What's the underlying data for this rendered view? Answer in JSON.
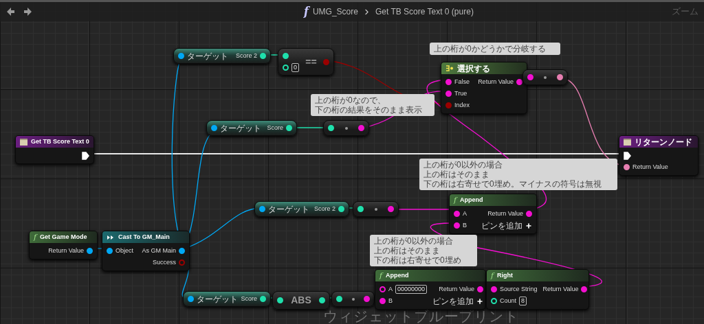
{
  "toolbar": {
    "glyph": "f",
    "breadcrumb": [
      "UMG_Score",
      "Get TB Score Text 0 (pure)"
    ],
    "zoom_label": "ズーム"
  },
  "nodes": [
    {
      "kind": "getter",
      "inputs": [
        {
          "label": "ターゲット",
          "kind": "object",
          "connected": true
        }
      ],
      "outputs": [
        {
          "label": "Score 2",
          "kind": "int",
          "connected": true
        }
      ]
    },
    {
      "kind": "compare",
      "title": "==",
      "inputs": [
        {
          "kind": "int",
          "connected": true
        },
        {
          "kind": "int",
          "connected": false,
          "value": "0"
        }
      ],
      "outputs": [
        {
          "kind": "bool",
          "connected": true
        }
      ]
    },
    {
      "kind": "getter",
      "inputs": [
        {
          "label": "ターゲット",
          "kind": "object",
          "connected": true
        }
      ],
      "outputs": [
        {
          "label": "Score",
          "kind": "int",
          "connected": true
        }
      ]
    },
    {
      "kind": "conversion",
      "inputs": [
        {
          "kind": "int",
          "connected": true
        }
      ],
      "outputs": [
        {
          "kind": "string",
          "connected": true
        }
      ]
    },
    {
      "kind": "select",
      "title": "選択する",
      "inputs": [
        {
          "label": "False",
          "kind": "string",
          "connected": true
        },
        {
          "label": "True",
          "kind": "string",
          "connected": true
        },
        {
          "label": "Index",
          "kind": "bool",
          "connected": true
        }
      ],
      "outputs": [
        {
          "label": "Return Value",
          "kind": "string",
          "connected": true
        }
      ]
    },
    {
      "kind": "conversion",
      "inputs": [
        {
          "kind": "string",
          "connected": true
        }
      ],
      "outputs": [
        {
          "kind": "text",
          "connected": true
        }
      ]
    },
    {
      "kind": "entry",
      "title": "Get TB Score Text 0",
      "outputs": [
        {
          "kind": "exec",
          "connected": true
        }
      ]
    },
    {
      "kind": "result",
      "title": "リターンノード",
      "inputs": [
        {
          "kind": "exec",
          "connected": true
        },
        {
          "label": "Return Value",
          "kind": "text",
          "connected": true
        }
      ]
    },
    {
      "kind": "getter",
      "inputs": [
        {
          "label": "ターゲット",
          "kind": "object",
          "connected": true
        }
      ],
      "outputs": [
        {
          "label": "Score 2",
          "kind": "int",
          "connected": true
        }
      ]
    },
    {
      "kind": "conversion",
      "inputs": [
        {
          "kind": "int",
          "connected": true
        }
      ],
      "outputs": [
        {
          "kind": "string",
          "connected": true
        }
      ]
    },
    {
      "kind": "function",
      "glyph": "f",
      "title": "Append",
      "inputs": [
        {
          "label": "A",
          "kind": "string",
          "connected": true
        },
        {
          "label": "B",
          "kind": "string",
          "connected": true
        }
      ],
      "outputs": [
        {
          "label": "Return Value",
          "kind": "string",
          "connected": true
        }
      ],
      "add_pin": "ピンを追加"
    },
    {
      "kind": "function",
      "glyph": "f",
      "title": "Get Game Mode",
      "outputs": [
        {
          "label": "Return Value",
          "kind": "object",
          "connected": true
        }
      ]
    },
    {
      "kind": "cast",
      "title": "Cast To GM_Main",
      "inputs": [
        {
          "label": "Object",
          "kind": "object",
          "connected": true
        }
      ],
      "outputs": [
        {
          "label": "As GM Main",
          "kind": "object",
          "connected": true
        },
        {
          "label": "Success",
          "kind": "bool",
          "connected": false
        }
      ]
    },
    {
      "kind": "getter",
      "inputs": [
        {
          "label": "ターゲット",
          "kind": "object",
          "connected": true
        }
      ],
      "outputs": [
        {
          "label": "Score",
          "kind": "int",
          "connected": true
        }
      ]
    },
    {
      "kind": "compare",
      "title": "ABS",
      "inputs": [
        {
          "kind": "int",
          "connected": true
        }
      ],
      "outputs": [
        {
          "kind": "int",
          "connected": true
        }
      ]
    },
    {
      "kind": "conversion",
      "inputs": [
        {
          "kind": "int",
          "connected": true
        }
      ],
      "outputs": [
        {
          "kind": "string",
          "connected": true
        }
      ]
    },
    {
      "kind": "function",
      "glyph": "f",
      "title": "Append",
      "inputs": [
        {
          "label": "A",
          "kind": "string",
          "connected": false,
          "value": "00000000"
        },
        {
          "label": "B",
          "kind": "string",
          "connected": true
        }
      ],
      "outputs": [
        {
          "label": "Return Value",
          "kind": "string",
          "connected": true
        }
      ],
      "add_pin": "ピンを追加"
    },
    {
      "kind": "function",
      "glyph": "f",
      "title": "Right",
      "inputs": [
        {
          "label": "Source String",
          "kind": "string",
          "connected": true
        },
        {
          "label": "Count",
          "kind": "int",
          "connected": false,
          "value": "8"
        }
      ],
      "outputs": [
        {
          "label": "Return Value",
          "kind": "string",
          "connected": true
        }
      ]
    }
  ],
  "comments": [
    {
      "lines": [
        "上の桁が0かどうかで分岐する"
      ]
    },
    {
      "lines": [
        "上の桁が0なので、",
        "下の桁の結果をそのまま表示"
      ]
    },
    {
      "lines": [
        "上の桁が0以外の場合",
        "上の桁はそのまま",
        "下の桁は右寄せで0埋め。マイナスの符号は無視"
      ]
    },
    {
      "lines": [
        "上の桁が0以外の場合",
        "上の桁はそのまま",
        "下の桁は右寄せで0埋め"
      ]
    }
  ],
  "graph_label": "ウィジェットブループリント"
}
